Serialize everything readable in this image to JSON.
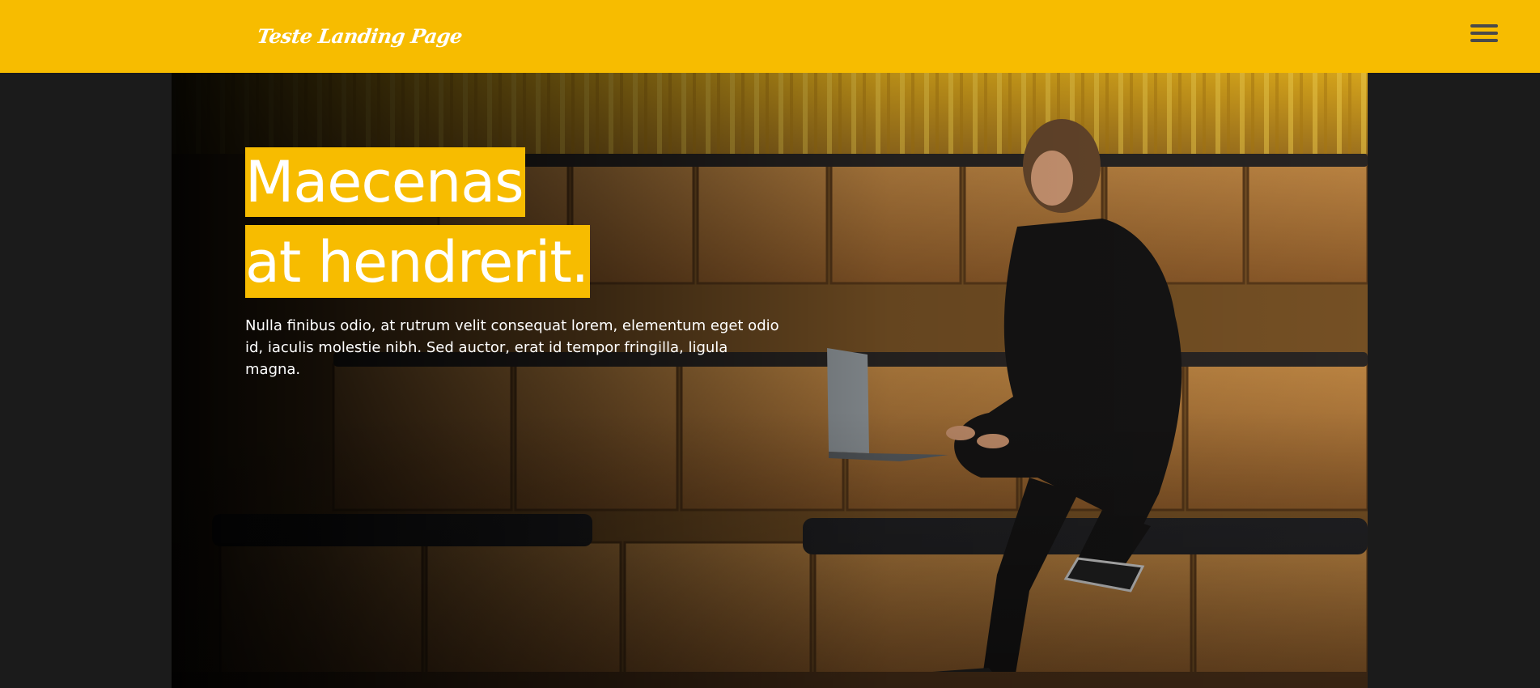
{
  "header": {
    "logo_text": "Teste Landing Page",
    "menu_icon": "hamburger-menu-icon",
    "background_color": "#f7bc00"
  },
  "hero": {
    "headline_line1": "Maecenas",
    "headline_line2": "at hendrerit.",
    "description": "Nulla finibus odio, at rutrum velit consequat lorem, elementum eget odio id, iaculis molestie nibh. Sed auctor, erat id tempor fringilla, ligula magna.",
    "highlight_color": "#f7bc00",
    "image_subject": "woman-with-laptop-on-wooden-steps"
  },
  "colors": {
    "page_background": "#1b1b1b",
    "accent": "#f7bc00",
    "text": "#ffffff"
  }
}
